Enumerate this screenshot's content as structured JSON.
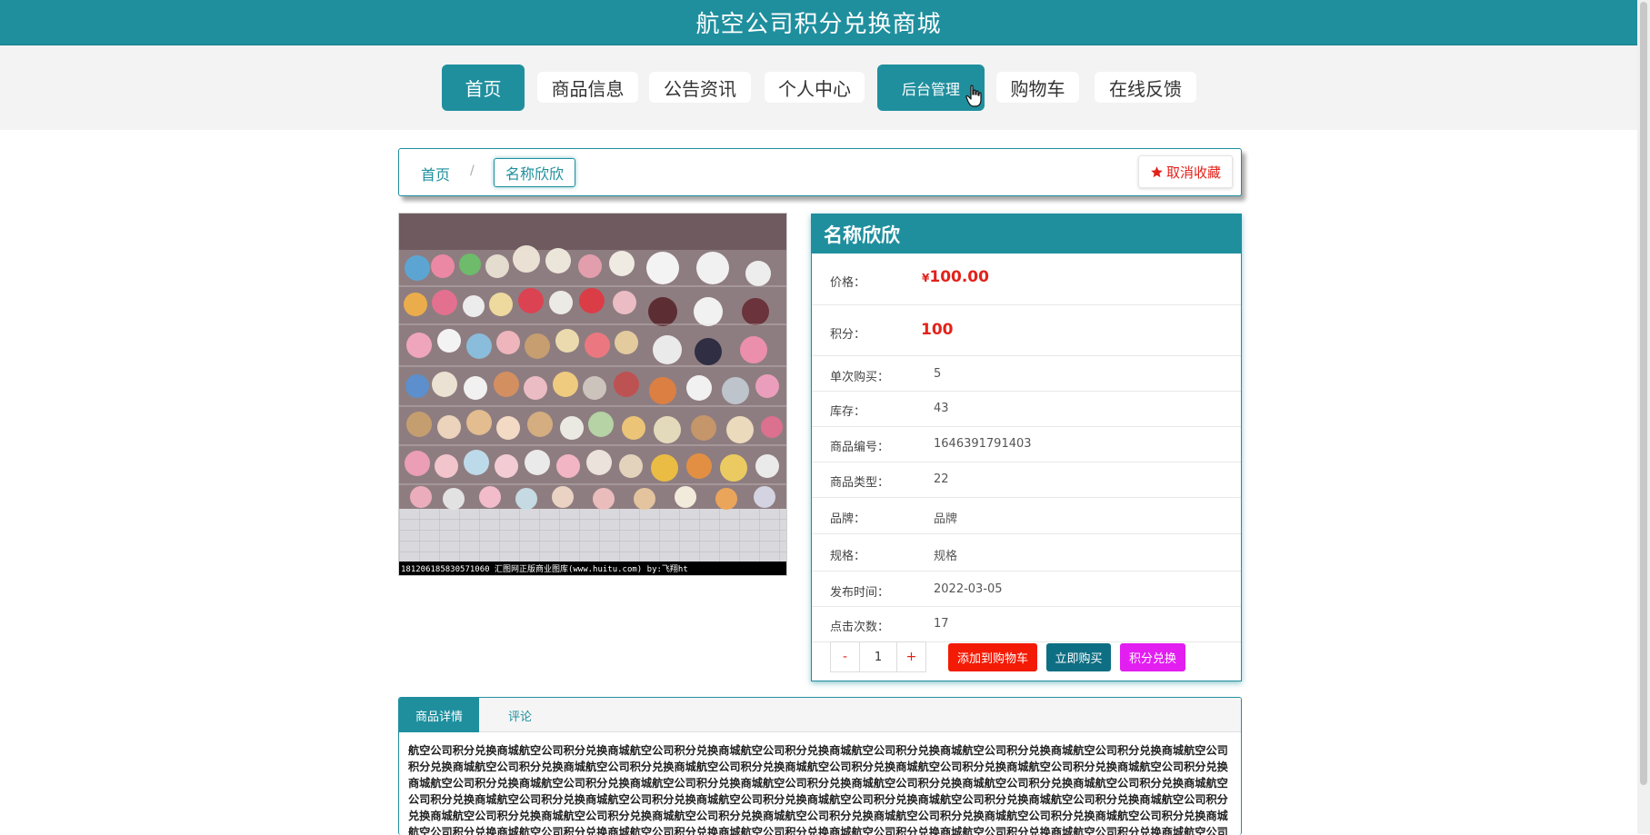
{
  "site": {
    "title": "航空公司积分兑换商城"
  },
  "nav": {
    "items": [
      {
        "label": "首页",
        "active": true
      },
      {
        "label": "商品信息",
        "active": false
      },
      {
        "label": "公告资讯",
        "active": false
      },
      {
        "label": "个人中心",
        "active": false
      },
      {
        "label": "后台管理",
        "active": true
      },
      {
        "label": "购物车",
        "active": false
      },
      {
        "label": "在线反馈",
        "active": false
      }
    ]
  },
  "breadcrumb": {
    "home": "首页",
    "separator": "/",
    "current": "名称欣欣",
    "favorite_label": "取消收藏",
    "favorite_icon": "star-icon"
  },
  "product": {
    "image_caption": "181206185830571060   汇图网正版商业图库(www.huitu.com) by:飞翔ht",
    "name": "名称欣欣",
    "price_label": "价格：",
    "price_currency": "¥",
    "price_value": "100.00",
    "points_label": "积分：",
    "points_value": "100",
    "fields": [
      {
        "label": "单次购买：",
        "value": "5"
      },
      {
        "label": "库存：",
        "value": "43"
      },
      {
        "label": "商品编号：",
        "value": "1646391791403"
      },
      {
        "label": "商品类型：",
        "value": "22"
      },
      {
        "label": "品牌：",
        "value": "品牌"
      },
      {
        "label": "规格：",
        "value": "规格"
      },
      {
        "label": "发布时间：",
        "value": "2022-03-05"
      },
      {
        "label": "点击次数：",
        "value": "17"
      }
    ],
    "quantity": {
      "minus": "-",
      "value": "1",
      "plus": "+"
    },
    "actions": {
      "add_cart": "添加到购物车",
      "buy_now": "立即购买",
      "points_exchange": "积分兑换"
    }
  },
  "details": {
    "tab_details": "商品详情",
    "tab_comments": "评论",
    "description": "航空公司积分兑换商城航空公司积分兑换商城航空公司积分兑换商城航空公司积分兑换商城航空公司积分兑换商城航空公司积分兑换商城航空公司积分兑换商城航空公司积分兑换商城航空公司积分兑换商城航空公司积分兑换商城航空公司积分兑换商城航空公司积分兑换商城航空公司积分兑换商城航空公司积分兑换商城航空公司积分兑换商城航空公司积分兑换商城航空公司积分兑换商城航空公司积分兑换商城航空公司积分兑换商城航空公司积分兑换商城航空公司积分兑换商城航空公司积分兑换商城航空公司积分兑换商城航空公司积分兑换商城航空公司积分兑换商城航空公司积分兑换商城航空公司积分兑换商城航空公司积分兑换商城航空公司积分兑换商城航空公司积分兑换商城航空公司积分兑换商城航空公司积分兑换商城航空公司积分兑换商城航空公司积分兑换商城航空公司积分兑换商城航空公司积分兑换商城航空公司积分兑换商城航空公司积分兑换商城航空公司积分兑换商城航空公司积分兑换商城航空公司积分兑换商城航空公司积分兑换商城航空公司积分兑换商城航空公司积分兑换商城航空公司积分兑换商城航空公司积分兑换商城航空公司积分兑换商城航空公司积分兑换商城航空公司积分兑换商城航空公司积分兑换商城"
  },
  "colors": {
    "primary": "#1f8f9e",
    "price_red": "#e3221a",
    "add_cart_bg": "#f31b05",
    "buy_now_bg": "#0e6f84",
    "points_bg": "#e21ef0"
  }
}
